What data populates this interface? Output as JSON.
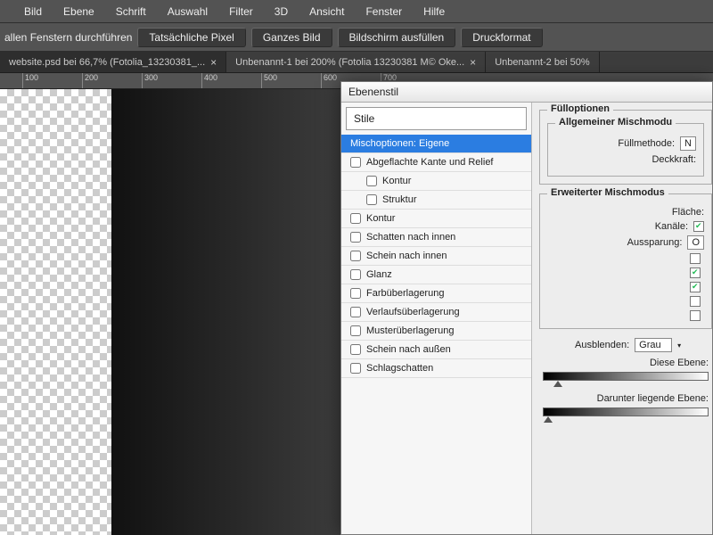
{
  "menu": [
    "Bild",
    "Ebene",
    "Schrift",
    "Auswahl",
    "Filter",
    "3D",
    "Ansicht",
    "Fenster",
    "Hilfe"
  ],
  "options": {
    "left_label": "allen Fenstern durchführen",
    "buttons": [
      "Tatsächliche Pixel",
      "Ganzes Bild",
      "Bildschirm ausfüllen",
      "Druckformat"
    ]
  },
  "tabs": [
    {
      "label": "website.psd bei 66,7% (Fotolia_13230381_...",
      "active": true
    },
    {
      "label": "Unbenannt-1 bei 200% (Fotolia 13230381 M© Oke...",
      "active": false
    },
    {
      "label": "Unbenannt-2 bei 50%",
      "active": false
    }
  ],
  "ruler_ticks": [
    100,
    200,
    300,
    400,
    500,
    600,
    700
  ],
  "dialog": {
    "title": "Ebenenstil",
    "styles_header": "Stile",
    "styles": [
      {
        "label": "Mischoptionen: Eigene",
        "selected": true,
        "nocb": true
      },
      {
        "label": "Abgeflachte Kante und Relief"
      },
      {
        "label": "Kontur",
        "indent": true
      },
      {
        "label": "Struktur",
        "indent": true
      },
      {
        "label": "Kontur"
      },
      {
        "label": "Schatten nach innen"
      },
      {
        "label": "Schein nach innen"
      },
      {
        "label": "Glanz"
      },
      {
        "label": "Farbüberlagerung"
      },
      {
        "label": "Verlaufsüberlagerung"
      },
      {
        "label": "Musterüberlagerung"
      },
      {
        "label": "Schein nach außen"
      },
      {
        "label": "Schlagschatten"
      }
    ],
    "fill": {
      "title": "Fülloptionen",
      "general_title": "Allgemeiner Mischmodu",
      "method_label": "Füllmethode:",
      "method_value": "N",
      "opacity_label": "Deckkraft:"
    },
    "adv": {
      "title": "Erweiterter Mischmodus",
      "area_label": "Fläche:",
      "channels_label": "Kanäle:",
      "knockout_label": "Aussparung:",
      "knockout_value": "O",
      "checks": [
        false,
        true,
        true,
        false,
        false
      ]
    },
    "blend": {
      "mode_label": "Ausblenden:",
      "mode_value": "Grau",
      "this_label": "Diese Ebene:",
      "under_label": "Darunter liegende Ebene:"
    }
  }
}
